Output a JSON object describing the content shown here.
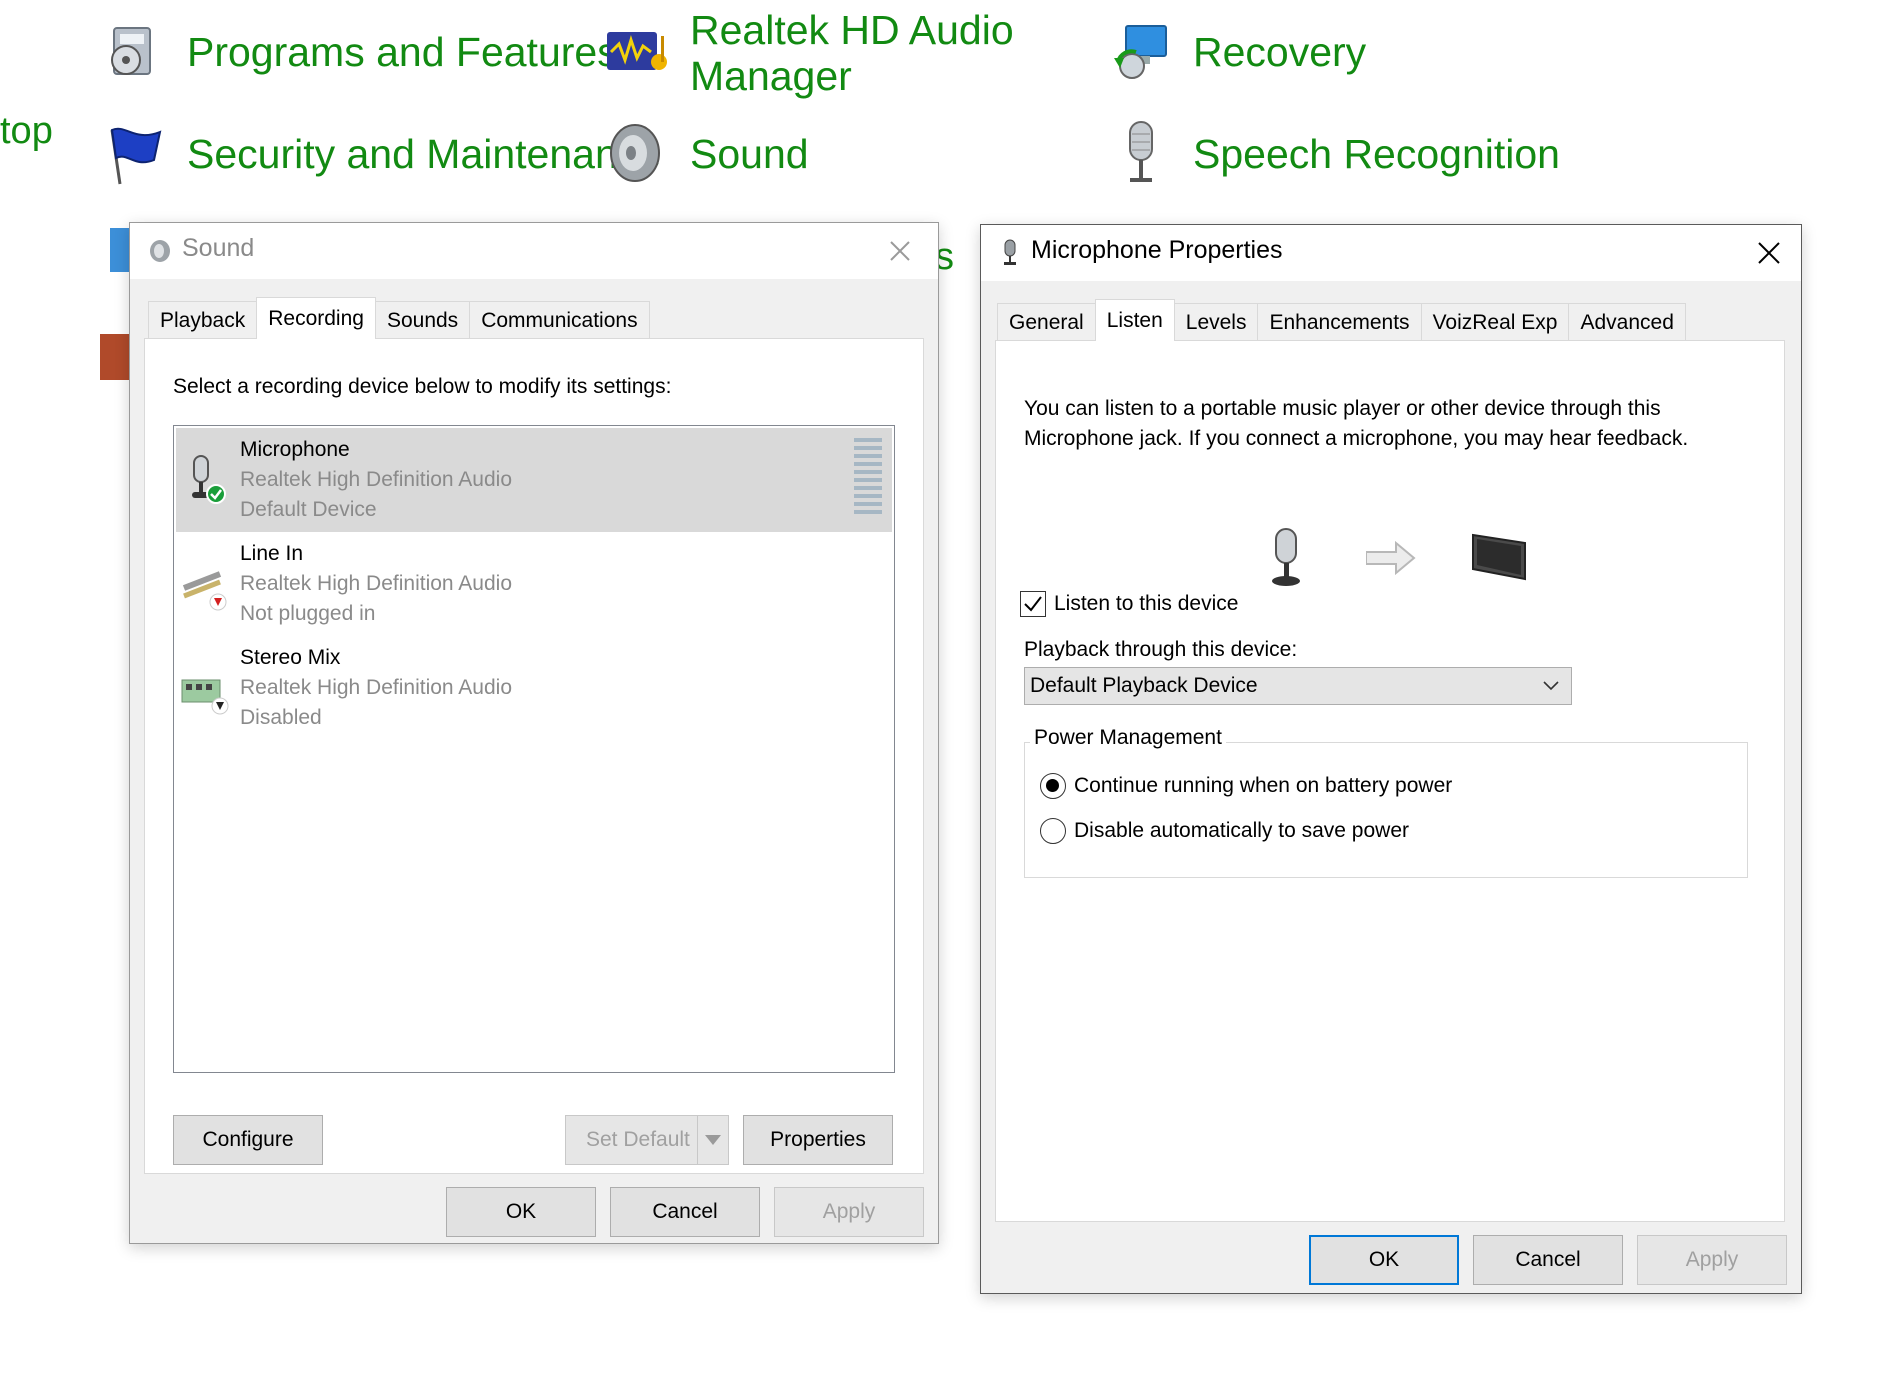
{
  "control_panel": {
    "items": [
      {
        "label": "Programs and Features",
        "icon": "programs-features-icon"
      },
      {
        "label": "Realtek HD Audio Manager",
        "line1": "Realtek HD Audio",
        "line2": "Manager",
        "icon": "realtek-audio-icon"
      },
      {
        "label": "Recovery",
        "icon": "recovery-icon"
      },
      {
        "label": "Security and Maintenance",
        "icon": "flag-icon"
      },
      {
        "label": "Sound",
        "icon": "speaker-icon"
      },
      {
        "label": "Speech Recognition",
        "icon": "microphone-icon"
      }
    ],
    "partial_left": "top",
    "partial_mid": "s",
    "accent_color": "#128a12"
  },
  "sound_dialog": {
    "title": "Sound",
    "tabs": [
      "Playback",
      "Recording",
      "Sounds",
      "Communications"
    ],
    "active_tab": "Recording",
    "instruction": "Select a recording device below to modify its settings:",
    "devices": [
      {
        "name": "Microphone",
        "driver": "Realtek High Definition Audio",
        "status": "Default Device",
        "icon": "microphone-device-icon",
        "badge": "default-check-icon",
        "selected": true
      },
      {
        "name": "Line In",
        "driver": "Realtek High Definition Audio",
        "status": "Not plugged in",
        "icon": "line-in-jack-icon",
        "badge": "unplugged-arrow-icon",
        "selected": false
      },
      {
        "name": "Stereo Mix",
        "driver": "Realtek High Definition Audio",
        "status": "Disabled",
        "icon": "sound-card-icon",
        "badge": "disabled-arrow-icon",
        "selected": false
      }
    ],
    "buttons": {
      "configure": "Configure",
      "set_default": "Set Default",
      "properties": "Properties",
      "ok": "OK",
      "cancel": "Cancel",
      "apply": "Apply"
    }
  },
  "mic_dialog": {
    "title": "Microphone Properties",
    "tabs": [
      "General",
      "Listen",
      "Levels",
      "Enhancements",
      "VoizReal Exp",
      "Advanced"
    ],
    "active_tab": "Listen",
    "description_line1": "You can listen to a portable music player or other device through this",
    "description_line2": "Microphone jack.  If you connect a microphone, you may hear feedback.",
    "listen_checkbox": {
      "label": "Listen to this device",
      "checked": true
    },
    "playback_label": "Playback through this device:",
    "playback_value": "Default Playback Device",
    "power_group": "Power Management",
    "power_options": [
      {
        "label": "Continue running when on battery power",
        "selected": true
      },
      {
        "label": "Disable automatically to save power",
        "selected": false
      }
    ],
    "buttons": {
      "ok": "OK",
      "cancel": "Cancel",
      "apply": "Apply"
    }
  }
}
